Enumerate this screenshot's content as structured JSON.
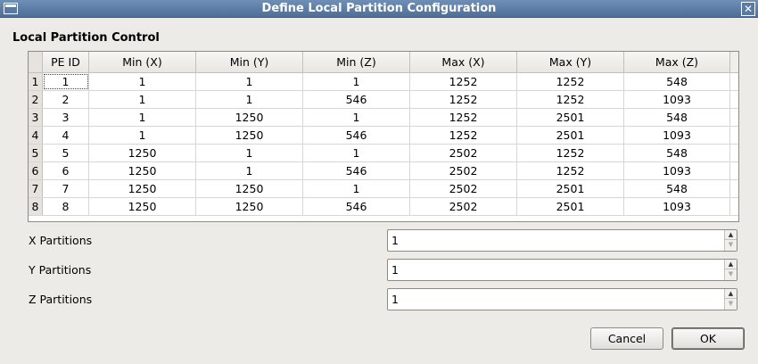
{
  "window": {
    "title": "Define Local Partition Configuration",
    "close_glyph": "✕"
  },
  "section": {
    "title": "Local Partition Control"
  },
  "table": {
    "columns": [
      "PE ID",
      "Min (X)",
      "Min (Y)",
      "Min (Z)",
      "Max (X)",
      "Max (Y)",
      "Max (Z)"
    ],
    "rows": [
      {
        "num": "1",
        "cells": [
          "1",
          "1",
          "1",
          "1",
          "1252",
          "1252",
          "548"
        ]
      },
      {
        "num": "2",
        "cells": [
          "2",
          "1",
          "1",
          "546",
          "1252",
          "1252",
          "1093"
        ]
      },
      {
        "num": "3",
        "cells": [
          "3",
          "1",
          "1250",
          "1",
          "1252",
          "2501",
          "548"
        ]
      },
      {
        "num": "4",
        "cells": [
          "4",
          "1",
          "1250",
          "546",
          "1252",
          "2501",
          "1093"
        ]
      },
      {
        "num": "5",
        "cells": [
          "5",
          "1250",
          "1",
          "1",
          "2502",
          "1252",
          "548"
        ]
      },
      {
        "num": "6",
        "cells": [
          "6",
          "1250",
          "1",
          "546",
          "2502",
          "1252",
          "1093"
        ]
      },
      {
        "num": "7",
        "cells": [
          "7",
          "1250",
          "1250",
          "1",
          "2502",
          "2501",
          "548"
        ]
      },
      {
        "num": "8",
        "cells": [
          "8",
          "1250",
          "1250",
          "546",
          "2502",
          "2501",
          "1093"
        ]
      }
    ]
  },
  "fields": [
    {
      "label": "X Partitions",
      "value": "1"
    },
    {
      "label": "Y Partitions",
      "value": "1"
    },
    {
      "label": "Z Partitions",
      "value": "1"
    }
  ],
  "buttons": {
    "cancel": "Cancel",
    "ok": "OK"
  }
}
